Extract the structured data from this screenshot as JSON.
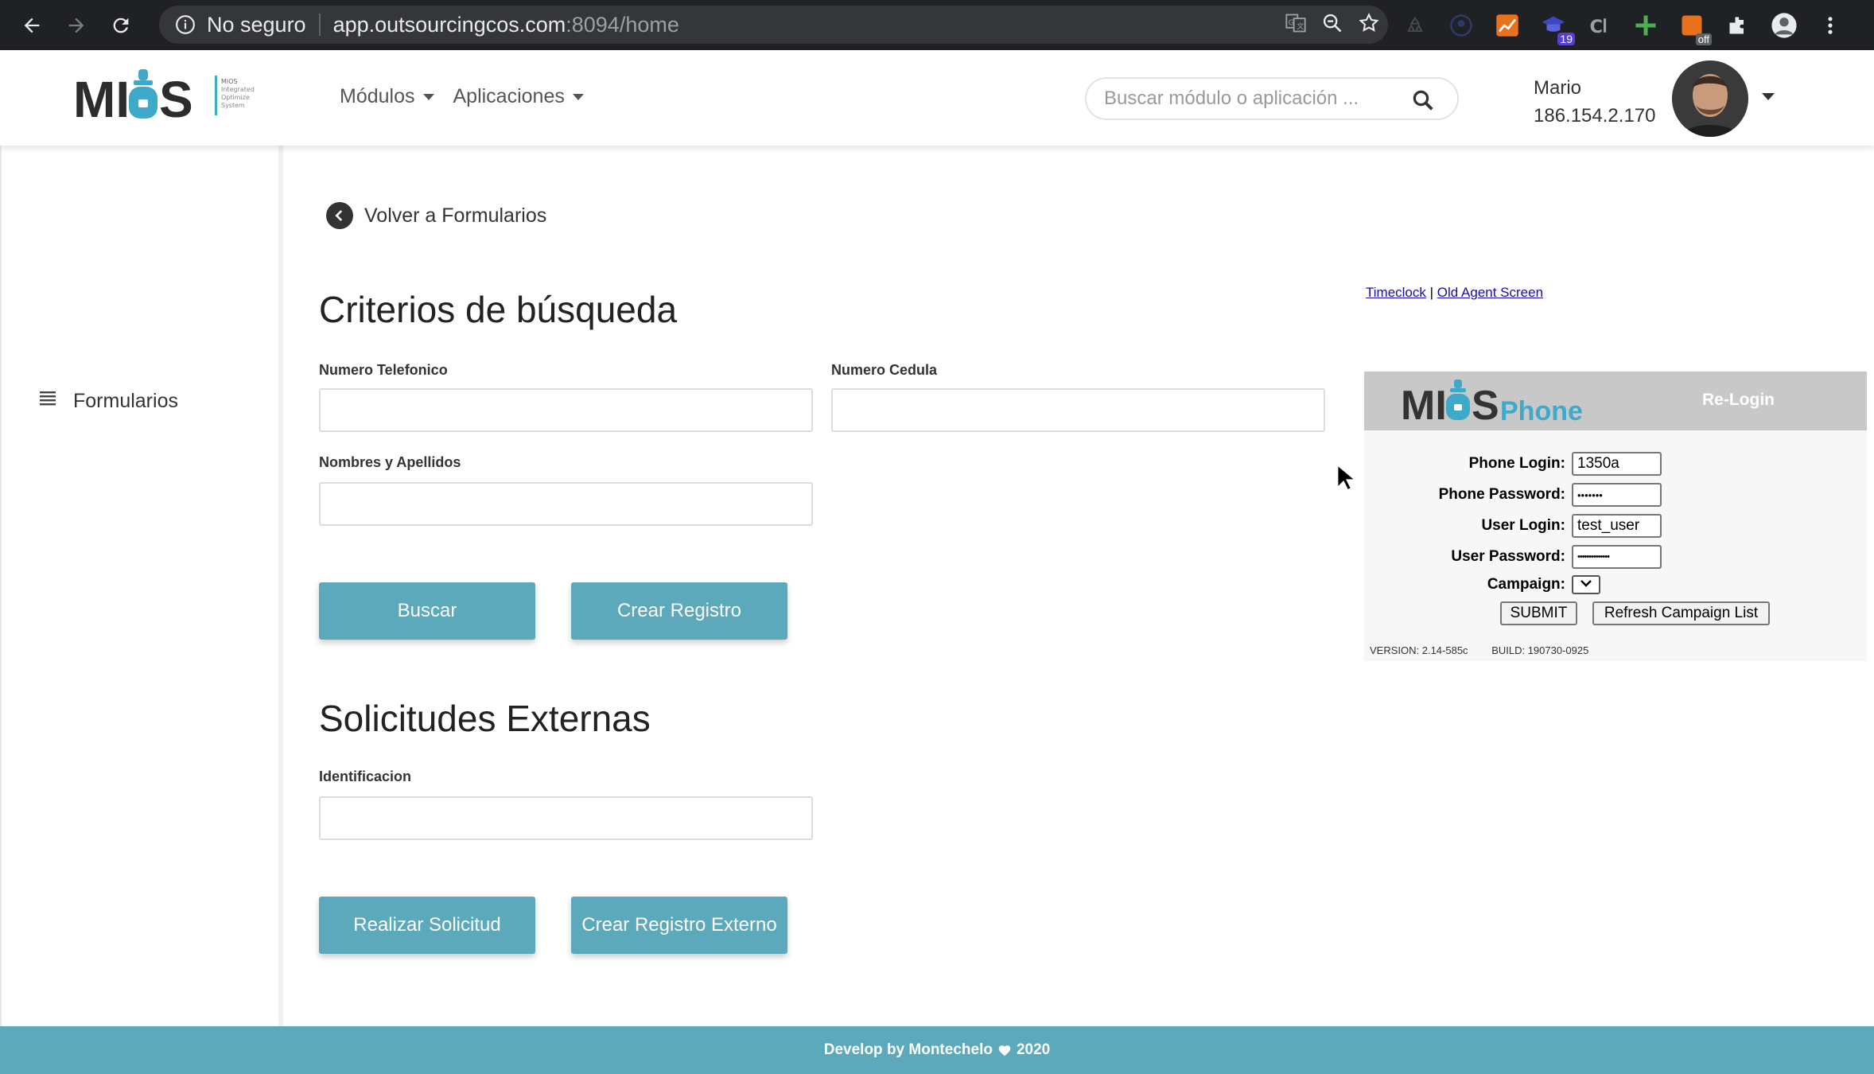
{
  "browser": {
    "security_label": "No seguro",
    "url_host": "app.outsourcingcos.com",
    "url_rest": ":8094/home",
    "extension_badge": "19",
    "extension_off_badge": "off"
  },
  "header": {
    "logo_text": "MIOS",
    "logo_tagline": [
      "MIOS",
      "Integrated",
      "Optimize",
      "System"
    ],
    "nav": [
      {
        "label": "Módulos"
      },
      {
        "label": "Aplicaciones"
      }
    ],
    "search_placeholder": "Buscar módulo o aplicación ...",
    "user_name": "Mario",
    "user_ip": "186.154.2.170"
  },
  "sidebar": {
    "items": [
      {
        "label": "Formularios",
        "icon": "list-icon"
      }
    ]
  },
  "main": {
    "back_label": "Volver a Formularios",
    "search_section": {
      "title": "Criterios de búsqueda",
      "fields": [
        {
          "label": "Numero Telefonico",
          "value": ""
        },
        {
          "label": "Numero Cedula",
          "value": ""
        },
        {
          "label": "Nombres y Apellidos",
          "value": ""
        }
      ],
      "buttons": {
        "search": "Buscar",
        "create": "Crear Registro"
      }
    },
    "external_section": {
      "title": "Solicitudes Externas",
      "fields": [
        {
          "label": "Identificacion",
          "value": ""
        }
      ],
      "buttons": {
        "request": "Realizar Solicitud",
        "create_external": "Crear Registro Externo"
      }
    }
  },
  "phone_panel": {
    "links": {
      "timeclock": "Timeclock",
      "separator": "|",
      "old_agent": "Old Agent Screen"
    },
    "brand": "MIOS",
    "brand_suffix": "Phone",
    "relogin": "Re-Login",
    "fields": {
      "phone_login_label": "Phone Login:",
      "phone_login_value": "1350a",
      "phone_password_label": "Phone Password:",
      "phone_password_value": "•••••••",
      "user_login_label": "User Login:",
      "user_login_value": "test_user",
      "user_password_label": "User Password:",
      "user_password_value": "••••••••••••••",
      "campaign_label": "Campaign:"
    },
    "buttons": {
      "submit": "SUBMIT",
      "refresh": "Refresh Campaign List"
    },
    "version": "VERSION: 2.14-585c",
    "build": "BUILD: 190730-0925"
  },
  "footer": {
    "text_before": "Develop by Montechelo",
    "text_after": "2020"
  },
  "colors": {
    "accent": "#5ba9ba",
    "logo_blue": "#3fa9c9",
    "chrome_bg": "#202124"
  }
}
